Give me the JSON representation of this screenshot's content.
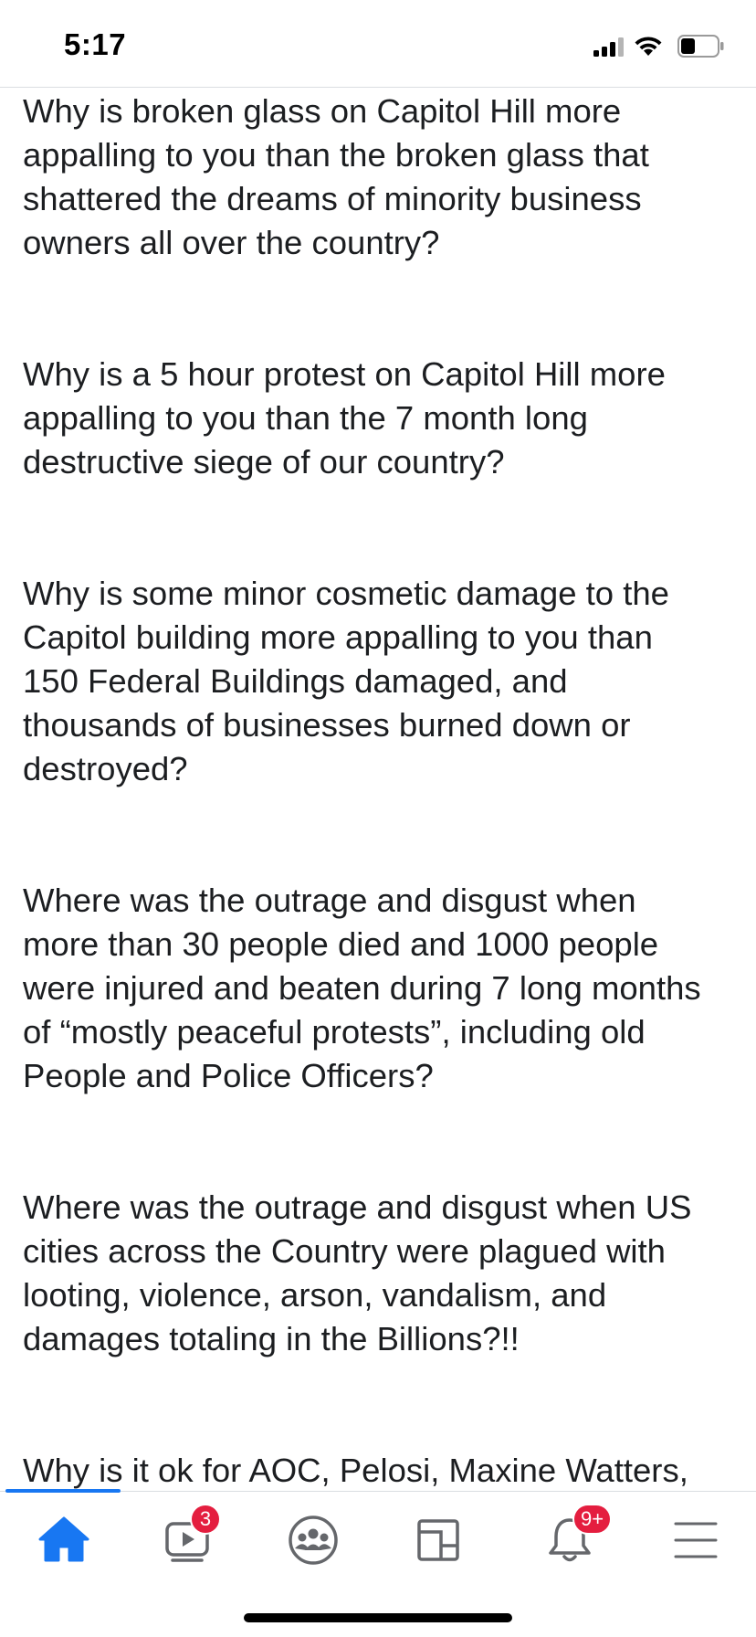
{
  "status_bar": {
    "time": "5:17",
    "icons": [
      "cellular-signal-icon",
      "wifi-icon",
      "battery-icon"
    ]
  },
  "post": {
    "paragraphs": [
      "Why is broken glass on Capitol Hill more\nappalling to you than the broken glass that\nshattered the dreams of minority business\nowners all over the country?",
      "Why is a 5 hour protest on Capitol Hill more\nappalling to you than the 7 month long\ndestructive siege of our country?",
      "Why is some minor cosmetic damage to the\nCapitol building more appalling to you than\n150 Federal Buildings damaged, and\nthousands of businesses burned down or\ndestroyed?",
      "Where was the outrage and disgust when\nmore than 30 people died and 1000 people\nwere injured and beaten during 7 long months\nof “mostly peaceful protests”, including old\nPeople and Police Officers?",
      "Where was the outrage and disgust when US\ncities across the Country were plagued with\nlooting, violence, arson, vandalism, and\ndamages totaling in the Billions?!!",
      "Why is it ok for AOC, Pelosi, Maxine Watters,"
    ]
  },
  "tab_bar": {
    "tabs": [
      {
        "name": "home",
        "icon": "home-icon",
        "badge": "",
        "active": true
      },
      {
        "name": "watch",
        "icon": "watch-icon",
        "badge": "3",
        "active": false
      },
      {
        "name": "groups",
        "icon": "groups-icon",
        "badge": "",
        "active": false
      },
      {
        "name": "pages",
        "icon": "pages-icon",
        "badge": "",
        "active": false
      },
      {
        "name": "notifications",
        "icon": "bell-icon",
        "badge": "9+",
        "active": false
      },
      {
        "name": "menu",
        "icon": "menu-icon",
        "badge": "",
        "active": false
      }
    ]
  },
  "colors": {
    "accent": "#1877f2",
    "badge": "#e41e3f",
    "text": "#1c1e21",
    "icon_inactive": "#65676b"
  }
}
